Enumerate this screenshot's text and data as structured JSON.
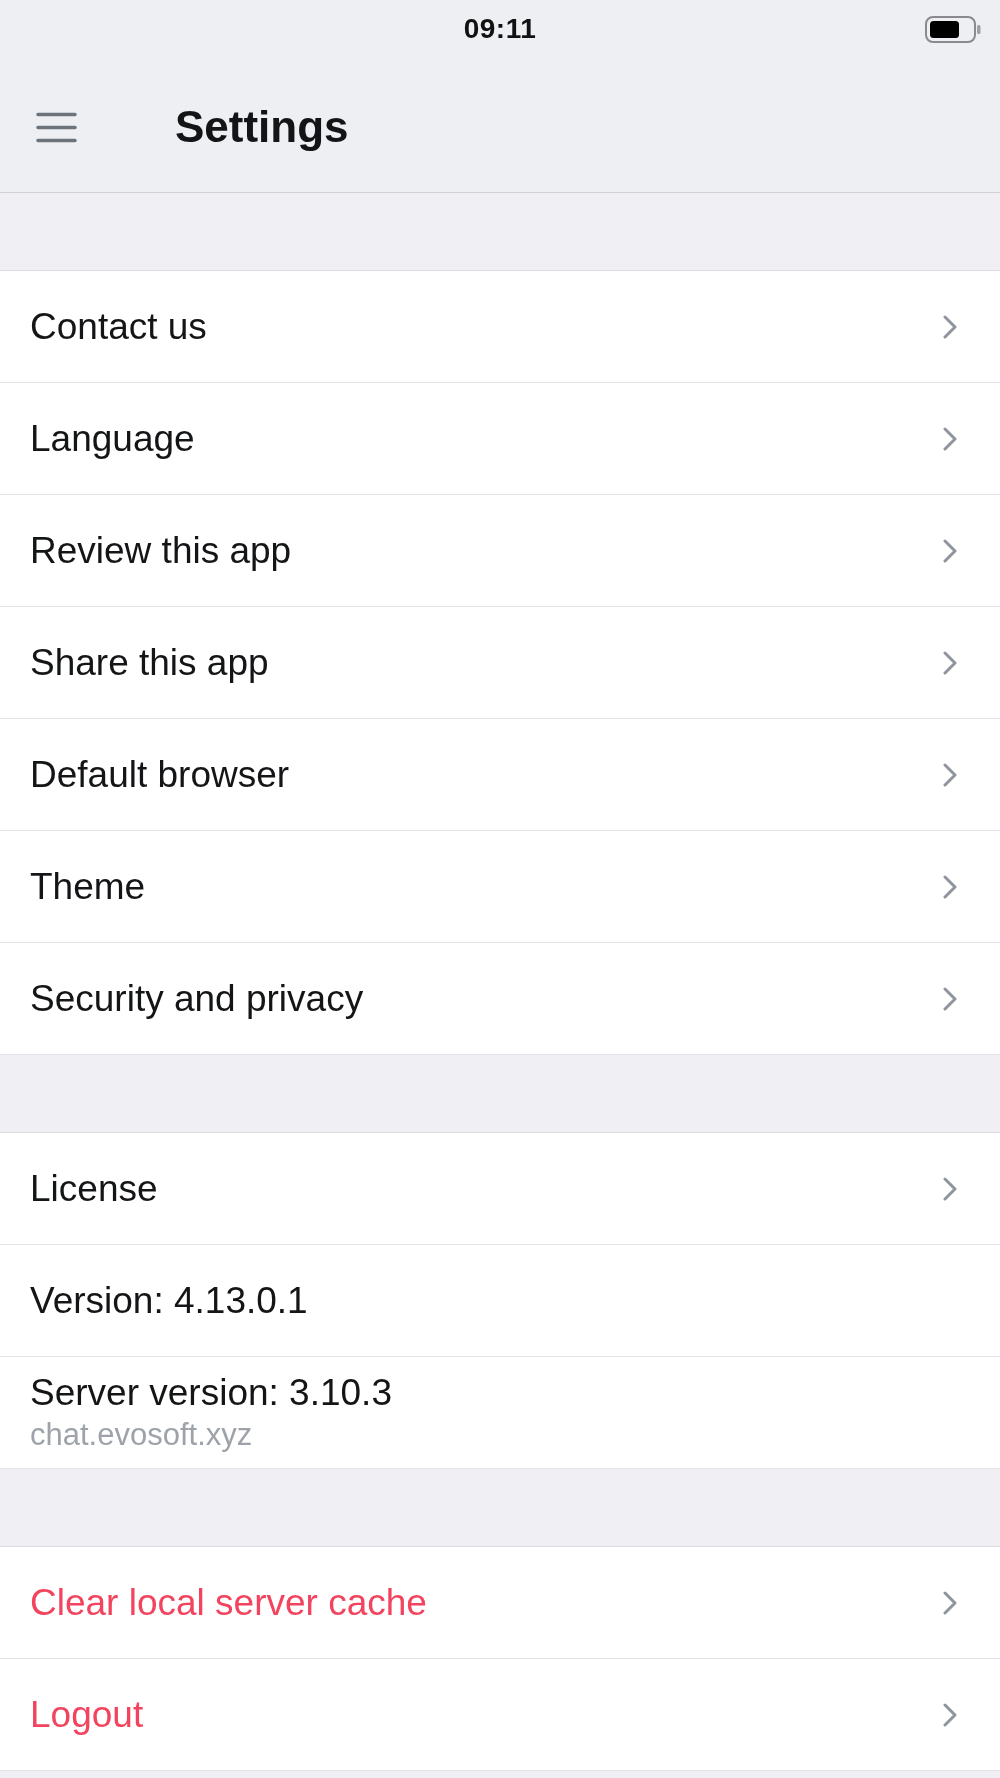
{
  "status_bar": {
    "time": "09:11"
  },
  "header": {
    "title": "Settings"
  },
  "sections": [
    {
      "items": [
        {
          "kind": "link",
          "label": "Contact us"
        },
        {
          "kind": "link",
          "label": "Language"
        },
        {
          "kind": "link",
          "label": "Review this app"
        },
        {
          "kind": "link",
          "label": "Share this app"
        },
        {
          "kind": "link",
          "label": "Default browser"
        },
        {
          "kind": "link",
          "label": "Theme"
        },
        {
          "kind": "link",
          "label": "Security and privacy"
        }
      ]
    },
    {
      "items": [
        {
          "kind": "link",
          "label": "License"
        },
        {
          "kind": "info",
          "label": "Version: 4.13.0.1"
        },
        {
          "kind": "info",
          "label": "Server version: 3.10.3",
          "subtitle": "chat.evosoft.xyz"
        }
      ]
    },
    {
      "items": [
        {
          "kind": "danger",
          "label": "Clear local server cache"
        },
        {
          "kind": "danger",
          "label": "Logout"
        }
      ]
    }
  ]
}
